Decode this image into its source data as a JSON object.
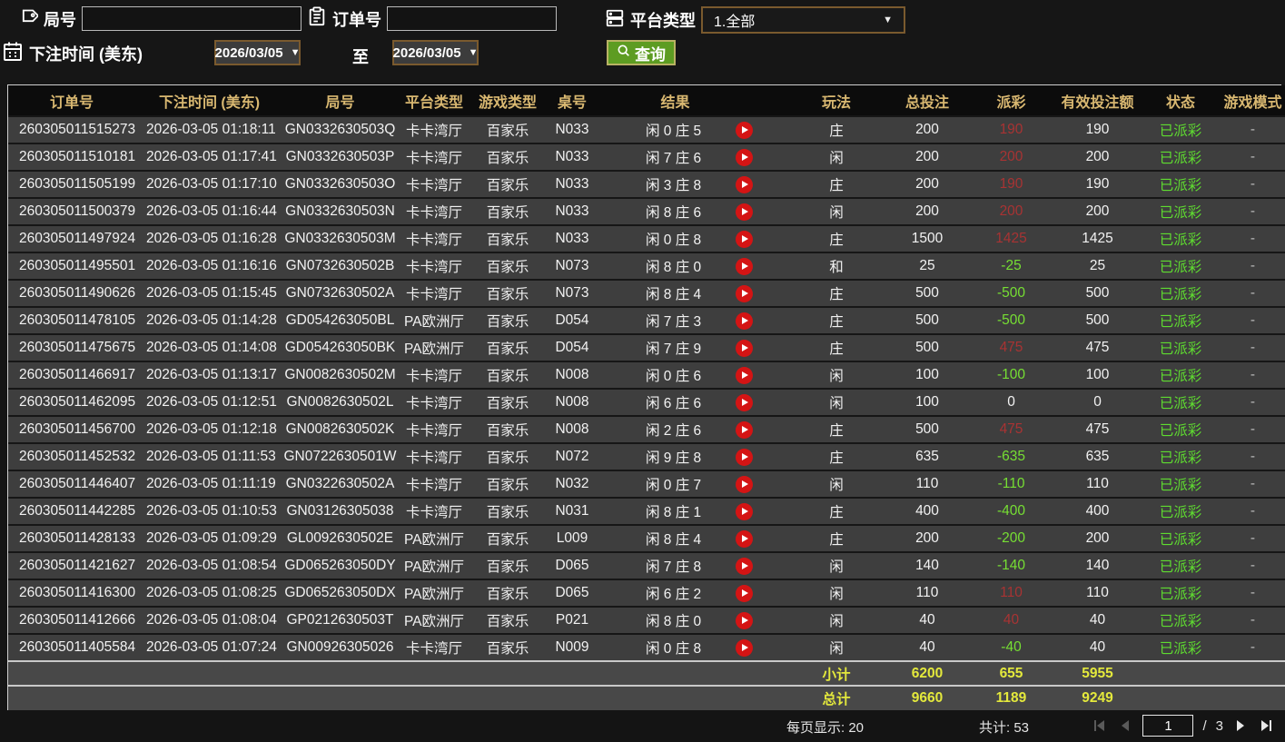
{
  "colors": {
    "win-red": "#a83333",
    "lose-green": "#76df33",
    "status-green": "#5fdc30",
    "sum-yellow": "#e4e93c",
    "accent-green": "#5d9c22",
    "header-gold": "#d9b871"
  },
  "filters": {
    "game_no_label": "局号",
    "order_no_label": "订单号",
    "platform_label": "平台类型",
    "platform_value": "1.全部",
    "bet_time_label": "下注时间 (美东)",
    "date_from": "2026/03/05",
    "date_to": "2026/03/05",
    "to_label": "至",
    "search_label": "查询",
    "caret": "▼"
  },
  "table": {
    "headers": [
      "订单号",
      "下注时间 (美东)",
      "局号",
      "平台类型",
      "游戏类型",
      "桌号",
      "结果",
      "玩法",
      "总投注",
      "派彩",
      "有效投注额",
      "状态",
      "游戏模式"
    ],
    "rows": [
      {
        "order_id": "260305011515273",
        "bet_time": "2026-03-05 01:18:11",
        "game_id": "GN0332630503Q",
        "platform": "卡卡湾厅",
        "game_type": "百家乐",
        "table_no": "N033",
        "result": "闲 0 庄 5",
        "play": "庄",
        "total_bet": "200",
        "payout": "190",
        "valid_bet": "190",
        "status": "已派彩",
        "mode": "-"
      },
      {
        "order_id": "260305011510181",
        "bet_time": "2026-03-05 01:17:41",
        "game_id": "GN0332630503P",
        "platform": "卡卡湾厅",
        "game_type": "百家乐",
        "table_no": "N033",
        "result": "闲 7 庄 6",
        "play": "闲",
        "total_bet": "200",
        "payout": "200",
        "valid_bet": "200",
        "status": "已派彩",
        "mode": "-"
      },
      {
        "order_id": "260305011505199",
        "bet_time": "2026-03-05 01:17:10",
        "game_id": "GN0332630503O",
        "platform": "卡卡湾厅",
        "game_type": "百家乐",
        "table_no": "N033",
        "result": "闲 3 庄 8",
        "play": "庄",
        "total_bet": "200",
        "payout": "190",
        "valid_bet": "190",
        "status": "已派彩",
        "mode": "-"
      },
      {
        "order_id": "260305011500379",
        "bet_time": "2026-03-05 01:16:44",
        "game_id": "GN0332630503N",
        "platform": "卡卡湾厅",
        "game_type": "百家乐",
        "table_no": "N033",
        "result": "闲 8 庄 6",
        "play": "闲",
        "total_bet": "200",
        "payout": "200",
        "valid_bet": "200",
        "status": "已派彩",
        "mode": "-"
      },
      {
        "order_id": "260305011497924",
        "bet_time": "2026-03-05 01:16:28",
        "game_id": "GN0332630503M",
        "platform": "卡卡湾厅",
        "game_type": "百家乐",
        "table_no": "N033",
        "result": "闲 0 庄 8",
        "play": "庄",
        "total_bet": "1500",
        "payout": "1425",
        "valid_bet": "1425",
        "status": "已派彩",
        "mode": "-"
      },
      {
        "order_id": "260305011495501",
        "bet_time": "2026-03-05 01:16:16",
        "game_id": "GN0732630502B",
        "platform": "卡卡湾厅",
        "game_type": "百家乐",
        "table_no": "N073",
        "result": "闲 8 庄 0",
        "play": "和",
        "total_bet": "25",
        "payout": "-25",
        "valid_bet": "25",
        "status": "已派彩",
        "mode": "-"
      },
      {
        "order_id": "260305011490626",
        "bet_time": "2026-03-05 01:15:45",
        "game_id": "GN0732630502A",
        "platform": "卡卡湾厅",
        "game_type": "百家乐",
        "table_no": "N073",
        "result": "闲 8 庄 4",
        "play": "庄",
        "total_bet": "500",
        "payout": "-500",
        "valid_bet": "500",
        "status": "已派彩",
        "mode": "-"
      },
      {
        "order_id": "260305011478105",
        "bet_time": "2026-03-05 01:14:28",
        "game_id": "GD054263050BL",
        "platform": "PA欧洲厅",
        "game_type": "百家乐",
        "table_no": "D054",
        "result": "闲 7 庄 3",
        "play": "庄",
        "total_bet": "500",
        "payout": "-500",
        "valid_bet": "500",
        "status": "已派彩",
        "mode": "-"
      },
      {
        "order_id": "260305011475675",
        "bet_time": "2026-03-05 01:14:08",
        "game_id": "GD054263050BK",
        "platform": "PA欧洲厅",
        "game_type": "百家乐",
        "table_no": "D054",
        "result": "闲 7 庄 9",
        "play": "庄",
        "total_bet": "500",
        "payout": "475",
        "valid_bet": "475",
        "status": "已派彩",
        "mode": "-"
      },
      {
        "order_id": "260305011466917",
        "bet_time": "2026-03-05 01:13:17",
        "game_id": "GN0082630502M",
        "platform": "卡卡湾厅",
        "game_type": "百家乐",
        "table_no": "N008",
        "result": "闲 0 庄 6",
        "play": "闲",
        "total_bet": "100",
        "payout": "-100",
        "valid_bet": "100",
        "status": "已派彩",
        "mode": "-"
      },
      {
        "order_id": "260305011462095",
        "bet_time": "2026-03-05 01:12:51",
        "game_id": "GN0082630502L",
        "platform": "卡卡湾厅",
        "game_type": "百家乐",
        "table_no": "N008",
        "result": "闲 6 庄 6",
        "play": "闲",
        "total_bet": "100",
        "payout": "0",
        "valid_bet": "0",
        "status": "已派彩",
        "mode": "-"
      },
      {
        "order_id": "260305011456700",
        "bet_time": "2026-03-05 01:12:18",
        "game_id": "GN0082630502K",
        "platform": "卡卡湾厅",
        "game_type": "百家乐",
        "table_no": "N008",
        "result": "闲 2 庄 6",
        "play": "庄",
        "total_bet": "500",
        "payout": "475",
        "valid_bet": "475",
        "status": "已派彩",
        "mode": "-"
      },
      {
        "order_id": "260305011452532",
        "bet_time": "2026-03-05 01:11:53",
        "game_id": "GN0722630501W",
        "platform": "卡卡湾厅",
        "game_type": "百家乐",
        "table_no": "N072",
        "result": "闲 9 庄 8",
        "play": "庄",
        "total_bet": "635",
        "payout": "-635",
        "valid_bet": "635",
        "status": "已派彩",
        "mode": "-"
      },
      {
        "order_id": "260305011446407",
        "bet_time": "2026-03-05 01:11:19",
        "game_id": "GN0322630502A",
        "platform": "卡卡湾厅",
        "game_type": "百家乐",
        "table_no": "N032",
        "result": "闲 0 庄 7",
        "play": "闲",
        "total_bet": "110",
        "payout": "-110",
        "valid_bet": "110",
        "status": "已派彩",
        "mode": "-"
      },
      {
        "order_id": "260305011442285",
        "bet_time": "2026-03-05 01:10:53",
        "game_id": "GN03126305038",
        "platform": "卡卡湾厅",
        "game_type": "百家乐",
        "table_no": "N031",
        "result": "闲 8 庄 1",
        "play": "庄",
        "total_bet": "400",
        "payout": "-400",
        "valid_bet": "400",
        "status": "已派彩",
        "mode": "-"
      },
      {
        "order_id": "260305011428133",
        "bet_time": "2026-03-05 01:09:29",
        "game_id": "GL0092630502E",
        "platform": "PA欧洲厅",
        "game_type": "百家乐",
        "table_no": "L009",
        "result": "闲 8 庄 4",
        "play": "庄",
        "total_bet": "200",
        "payout": "-200",
        "valid_bet": "200",
        "status": "已派彩",
        "mode": "-"
      },
      {
        "order_id": "260305011421627",
        "bet_time": "2026-03-05 01:08:54",
        "game_id": "GD065263050DY",
        "platform": "PA欧洲厅",
        "game_type": "百家乐",
        "table_no": "D065",
        "result": "闲 7 庄 8",
        "play": "闲",
        "total_bet": "140",
        "payout": "-140",
        "valid_bet": "140",
        "status": "已派彩",
        "mode": "-"
      },
      {
        "order_id": "260305011416300",
        "bet_time": "2026-03-05 01:08:25",
        "game_id": "GD065263050DX",
        "platform": "PA欧洲厅",
        "game_type": "百家乐",
        "table_no": "D065",
        "result": "闲 6 庄 2",
        "play": "闲",
        "total_bet": "110",
        "payout": "110",
        "valid_bet": "110",
        "status": "已派彩",
        "mode": "-"
      },
      {
        "order_id": "260305011412666",
        "bet_time": "2026-03-05 01:08:04",
        "game_id": "GP0212630503T",
        "platform": "PA欧洲厅",
        "game_type": "百家乐",
        "table_no": "P021",
        "result": "闲 8 庄 0",
        "play": "闲",
        "total_bet": "40",
        "payout": "40",
        "valid_bet": "40",
        "status": "已派彩",
        "mode": "-"
      },
      {
        "order_id": "260305011405584",
        "bet_time": "2026-03-05 01:07:24",
        "game_id": "GN00926305026",
        "platform": "卡卡湾厅",
        "game_type": "百家乐",
        "table_no": "N009",
        "result": "闲 0 庄 8",
        "play": "闲",
        "total_bet": "40",
        "payout": "-40",
        "valid_bet": "40",
        "status": "已派彩",
        "mode": "-"
      }
    ],
    "subtotal": {
      "label": "小计",
      "total_bet": "6200",
      "payout": "655",
      "valid_bet": "5955"
    },
    "total": {
      "label": "总计",
      "total_bet": "9660",
      "payout": "1189",
      "valid_bet": "9249"
    }
  },
  "footer": {
    "page_size_label": "每页显示: 20",
    "total_count_label": "共计: 53",
    "page": "1",
    "page_separator": "/",
    "total_pages": "3"
  }
}
